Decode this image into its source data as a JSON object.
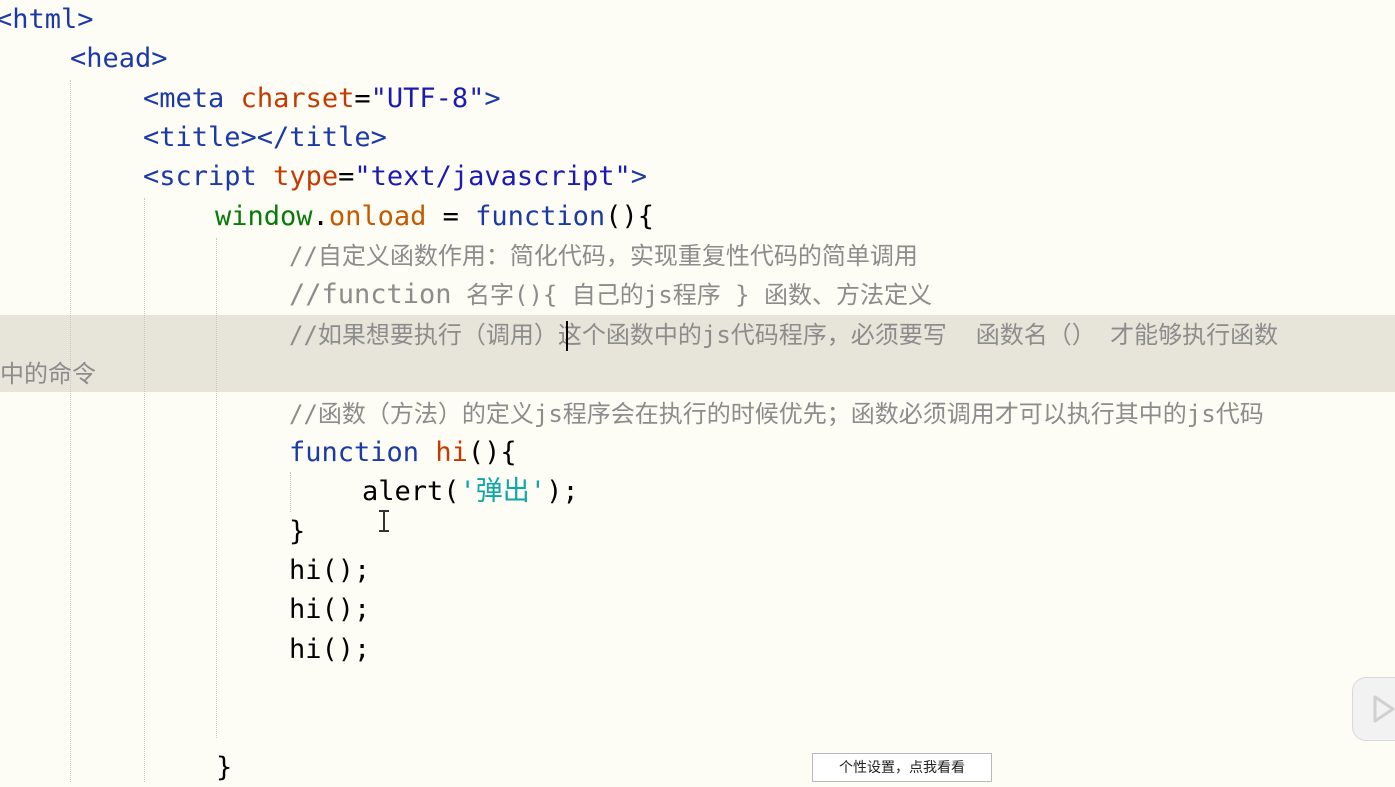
{
  "code": {
    "line1": {
      "open": "<",
      "tag": "html",
      "close": ">"
    },
    "line2": {
      "open": "<",
      "tag": "head",
      "close": ">"
    },
    "line3": {
      "open": "<",
      "tag": "meta",
      "attr": "charset",
      "eq": "=",
      "value": "\"UTF-8\"",
      "close": ">"
    },
    "line4": {
      "text": "<title></title>"
    },
    "line5": {
      "open": "<",
      "tag": "script",
      "attr": "type",
      "eq": "=",
      "value": "\"text/javascript\"",
      "close": ">"
    },
    "line6": {
      "obj": "window",
      "dot": ".",
      "prop": "onload",
      "assign": " = ",
      "kw": "function",
      "rest": "(){"
    },
    "comment1": "//自定义函数作用：简化代码，实现重复性代码的简单调用",
    "comment2_a": "//function",
    "comment2_b": " 名字(){ 自己的js程序 } 函数、方法定义",
    "comment3_a": "//如果想要执行（调用",
    "comment3_b": "）这个函数中的js代码程序，必须要写  函数名（） 才能够执行函数",
    "comment3_wrap": "中的命令",
    "comment4": "//函数（方法）的定义js程序会在执行的时候优先；函数必须调用才可以执行其中的js代码",
    "fn_kw": "function",
    "fn_name": "hi",
    "fn_rest": "(){",
    "alert_call": "alert(",
    "alert_arg": "'弹出'",
    "alert_end": ");",
    "close_brace": "}",
    "call1": "hi();",
    "call2": "hi();",
    "call3": "hi();",
    "outer_close": "}"
  },
  "tooltip": "个性设置，点我看看",
  "icons": {
    "play": "play-icon",
    "cursor": "text-cursor-icon"
  }
}
